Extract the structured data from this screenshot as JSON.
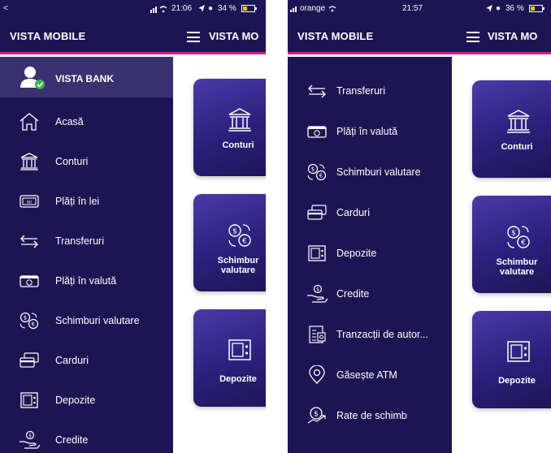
{
  "left_screen": {
    "status": {
      "left": "<",
      "time": "21:06",
      "battery": "34 %"
    },
    "brand": "VISTA MOBILE",
    "app_title": "VISTA MO",
    "drawer_header": "VISTA BANK",
    "menu": [
      {
        "label": "Acasă",
        "icon": "home-icon"
      },
      {
        "label": "Conturi",
        "icon": "bank-icon"
      },
      {
        "label": "Plăți în lei",
        "icon": "banknote-icon"
      },
      {
        "label": "Transferuri",
        "icon": "transfer-arrows-icon"
      },
      {
        "label": "Plăți în valută",
        "icon": "foreign-payment-icon"
      },
      {
        "label": "Schimburi valutare",
        "icon": "currency-exchange-icon"
      },
      {
        "label": "Carduri",
        "icon": "cards-icon"
      },
      {
        "label": "Depozite",
        "icon": "safe-icon"
      },
      {
        "label": "Credite",
        "icon": "credit-hand-icon"
      }
    ],
    "tiles": [
      {
        "label": "Conturi",
        "icon": "bank-icon"
      },
      {
        "label": "Schimburi valutare",
        "line1": "Schimbur",
        "line2": "valutare",
        "icon": "currency-exchange-icon"
      },
      {
        "label": "Depozite",
        "icon": "safe-icon"
      }
    ]
  },
  "right_screen": {
    "status": {
      "carrier": "orange",
      "time": "21:57",
      "battery": "36 %"
    },
    "brand": "VISTA MOBILE",
    "app_title": "VISTA MO",
    "menu": [
      {
        "label": "Transferuri",
        "icon": "transfer-arrows-icon"
      },
      {
        "label": "Plăți în valută",
        "icon": "foreign-payment-icon"
      },
      {
        "label": "Schimburi valutare",
        "icon": "currency-exchange-icon"
      },
      {
        "label": "Carduri",
        "icon": "cards-icon"
      },
      {
        "label": "Depozite",
        "icon": "safe-icon"
      },
      {
        "label": "Credite",
        "icon": "credit-hand-icon"
      },
      {
        "label": "Tranzacții de autor...",
        "icon": "transactions-icon"
      },
      {
        "label": "Găsește ATM",
        "icon": "location-pin-icon"
      },
      {
        "label": "Rate de schimb",
        "icon": "exchange-rate-icon"
      }
    ],
    "tiles": [
      {
        "label": "Conturi",
        "icon": "bank-icon"
      },
      {
        "label": "Schimburi valutare",
        "line1": "Schimbur",
        "line2": "valutare",
        "icon": "currency-exchange-icon"
      },
      {
        "label": "Depozite",
        "icon": "safe-icon"
      }
    ]
  },
  "colors": {
    "navy": "#1d1553",
    "header_highlight": "#3a3170",
    "accent": "#e1147b",
    "tile_top": "#4a3aa8"
  }
}
